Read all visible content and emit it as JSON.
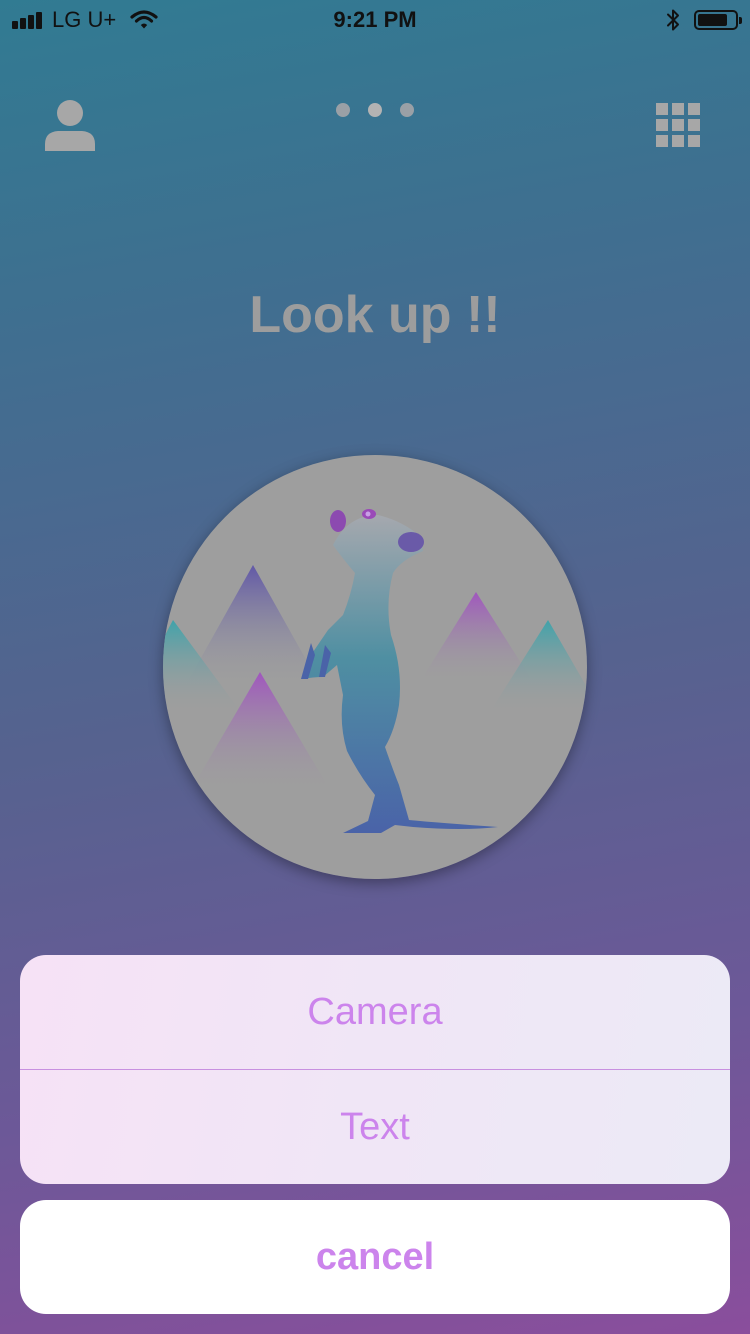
{
  "status_bar": {
    "carrier": "LG U+",
    "time": "9:21 PM",
    "signal_bars": 4,
    "battery_level": 0.8,
    "icons": [
      "signal-icon",
      "wifi-icon",
      "bluetooth-icon",
      "battery-icon"
    ]
  },
  "top_bar": {
    "left_icon": "person-icon",
    "right_icon": "grid-menu-icon",
    "page_indicator": {
      "count": 3,
      "active_index": 1
    }
  },
  "main": {
    "title": "Look up !!",
    "hero_image": "meerkat-mountains-illustration"
  },
  "action_sheet": {
    "options": [
      {
        "label": "Camera"
      },
      {
        "label": "Text"
      }
    ],
    "cancel_label": "cancel"
  },
  "colors": {
    "background_top": "#317b92",
    "background_bottom": "#8a4e9c",
    "accent_text": "#cc84ec",
    "title_gray": "#9d9d9d",
    "icon_gray": "#a7a7a7",
    "hero_circle": "#9e9e9e",
    "sheet_background": "#f2e6f6",
    "cancel_background": "#ffffff"
  }
}
